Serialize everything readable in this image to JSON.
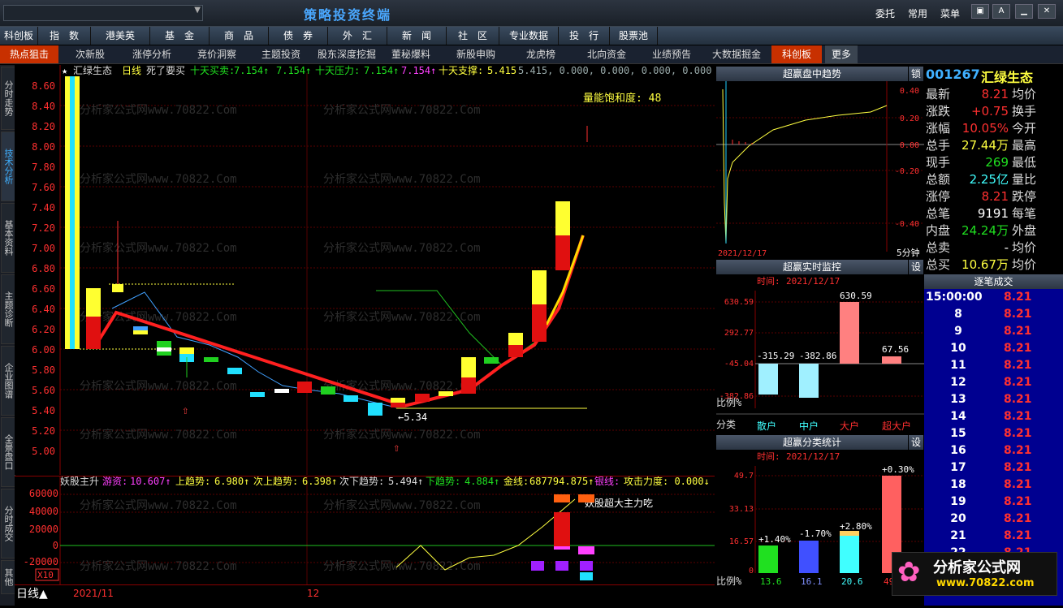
{
  "app": {
    "title": "策略投资终端",
    "top_buttons": [
      "委托",
      "常用",
      "菜单"
    ]
  },
  "menu": [
    "科创板",
    "指　数",
    "港美英",
    "基　金",
    "商　品",
    "债　券",
    "外　汇",
    "新　闻",
    "社　区",
    "专业数据",
    "投　行",
    "股票池"
  ],
  "submenu": [
    "热点狙击",
    "次新股",
    "涨停分析",
    "竞价洞察",
    "主题投资",
    "股东深度挖掘",
    "董秘爆料",
    "新股申购",
    "龙虎榜",
    "北向资金",
    "业绩预告",
    "大数据掘金",
    "科创板",
    "更多"
  ],
  "left_tabs": [
    "分时走势",
    "技术分析",
    "基本资料",
    "主题诊断",
    "企业图谱",
    "全景盘口",
    "分时成交",
    "其他"
  ],
  "chart_header": {
    "stock": "汇绿生态",
    "period": "日线",
    "formula": "死了要买",
    "i1_name": "十天买卖:",
    "i1_val": "7.154↑",
    "i1_val2": "7.154↑",
    "i2_name": "十天压力:",
    "i2_val": "7.154↑",
    "i2_val2": "7.154↑",
    "i3_name": "十天支撑:",
    "i3_val": "5.415",
    "i3_rest": "5.415, 0.000, 0.000, 0.000, 0.000",
    "volume_sat": "量能饱和度: 48",
    "low_label": "←5.34"
  },
  "price_axis": [
    "8.60",
    "8.40",
    "8.20",
    "8.00",
    "7.80",
    "7.60",
    "7.40",
    "7.20",
    "7.00",
    "6.80",
    "6.60",
    "6.40",
    "6.20",
    "6.00",
    "5.80",
    "5.60",
    "5.40",
    "5.20",
    "5.00"
  ],
  "sub_header": {
    "name": "妖股主升",
    "a_name": "游资:",
    "a_val": "10.607↑",
    "b_name": "上趋势:",
    "b_val": "6.980↑",
    "c_name": "次上趋势:",
    "c_val": "6.398↑",
    "d_name": "次下趋势:",
    "d_val": "5.494↑",
    "e_name": "下趋势:",
    "e_val": "4.884↑",
    "f_name": "金线:",
    "f_val": "687794.875↑",
    "g_name": "银线:",
    "g_val": "攻击力度: 0.000↓",
    "bang": "榜",
    "annotation": "妖股超大主力吃",
    "multiplier": "X10"
  },
  "sub_axis": [
    "60000",
    "40000",
    "20000",
    "0",
    "-20000"
  ],
  "bottom": {
    "period": "日线▲",
    "date1": "2021/11",
    "date2": "12"
  },
  "watermark": "分析家公式网www.70822.Com",
  "trend_panel": {
    "title": "超赢盘中趋势",
    "lock": "锁",
    "date": "2021/12/17",
    "interval": "5分钟",
    "axis": [
      "0.40",
      "0.20",
      "0.00",
      "-0.20",
      "-0.40"
    ]
  },
  "quote": {
    "code": "001267",
    "name": "汇绿生态",
    "rows": [
      {
        "l1": "最新",
        "v1": "8.21",
        "l2": "均价",
        "v2": ""
      },
      {
        "l1": "涨跌",
        "v1": "+0.75",
        "l2": "换手",
        "v2": ""
      },
      {
        "l1": "涨幅",
        "v1": "10.05%",
        "l2": "今开",
        "v2": ""
      },
      {
        "l1": "总手",
        "v1": "27.44万",
        "l2": "最高",
        "v2": ""
      },
      {
        "l1": "现手",
        "v1": "269",
        "l2": "最低",
        "v2": ""
      },
      {
        "l1": "总额",
        "v1": "2.25亿",
        "l2": "量比",
        "v2": ""
      },
      {
        "l1": "涨停",
        "v1": "8.21",
        "l2": "跌停",
        "v2": ""
      },
      {
        "l1": "总笔",
        "v1": "9191",
        "l2": "每笔",
        "v2": ""
      },
      {
        "l1": "内盘",
        "v1": "24.24万",
        "l2": "外盘",
        "v2": ""
      },
      {
        "l1": "总卖",
        "v1": "-",
        "l2": "均价",
        "v2": ""
      },
      {
        "l1": "总买",
        "v1": "10.67万",
        "l2": "均价",
        "v2": ""
      }
    ]
  },
  "monitor": {
    "title": "超赢实时监控",
    "setting": "设",
    "time_label": "时间:",
    "date": "2021/12/17",
    "axis": [
      "630.59",
      "292.77",
      "-45.04",
      "-382.86"
    ],
    "values": [
      "-315.29",
      "-382.86",
      "630.59",
      "67.56"
    ],
    "ratio_label": "比例%",
    "category_label": "分类",
    "categories": [
      "散户",
      "中户",
      "大户",
      "超大户"
    ]
  },
  "classify": {
    "title": "超赢分类统计",
    "setting": "设",
    "time_label": "时间:",
    "date": "2021/12/17",
    "axis": [
      "49.7",
      "33.13",
      "16.57",
      "0"
    ],
    "pct": [
      "+1.40%",
      "-1.70%",
      "+2.80%",
      "+0.30%"
    ],
    "ratio_label": "比例%",
    "ratios": [
      "13.6",
      "16.1",
      "20.6",
      "49"
    ]
  },
  "trades": {
    "title": "逐笔成交",
    "rows": [
      {
        "time": "15:00:00",
        "price": "8.21"
      },
      {
        "time": "8",
        "price": "8.21"
      },
      {
        "time": "9",
        "price": "8.21"
      },
      {
        "time": "10",
        "price": "8.21"
      },
      {
        "time": "11",
        "price": "8.21"
      },
      {
        "time": "12",
        "price": "8.21"
      },
      {
        "time": "13",
        "price": "8.21"
      },
      {
        "time": "14",
        "price": "8.21"
      },
      {
        "time": "15",
        "price": "8.21"
      },
      {
        "time": "16",
        "price": "8.21"
      },
      {
        "time": "17",
        "price": "8.21"
      },
      {
        "time": "18",
        "price": "8.21"
      },
      {
        "time": "19",
        "price": "8.21"
      },
      {
        "time": "20",
        "price": "8.21"
      },
      {
        "time": "21",
        "price": "8.21"
      },
      {
        "time": "22",
        "price": "8.21"
      }
    ]
  },
  "logo": {
    "name": "分析家公式网",
    "url": "www.70822.com"
  },
  "colors": {
    "up": "#ff2020",
    "down": "#20d020",
    "accent": "#ffd800",
    "line_blue": "#40a0ff"
  }
}
